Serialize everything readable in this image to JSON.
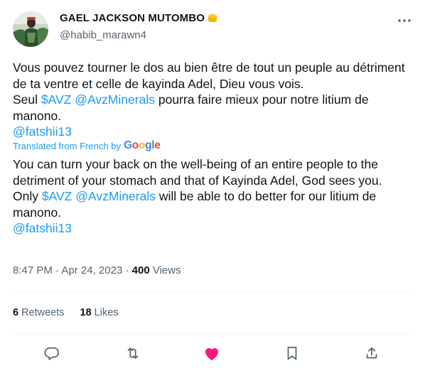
{
  "author": {
    "display_name": "GAEL JACKSON MUTOMBO",
    "name_emoji_icon": "raised-fist-icon",
    "handle": "@habib_marawn4"
  },
  "tweet": {
    "original": {
      "line1": "Vous pouvez tourner le dos au bien être de tout un peuple au détriment de ta ventre et celle de kayinda Adel, Dieu vous vois.",
      "seul": "Seul ",
      "cashtag": "$AVZ",
      "mention": "@AvzMinerals",
      "rest": " pourra faire mieux pour notre litium de manono.",
      "mention2": "@fatshii13"
    },
    "translation_label": "Translated from French by",
    "translation_provider": "Google",
    "translated": {
      "line1": "You can turn your back on the well-being of an entire people to the detriment of your stomach and that of Kayinda Adel, God sees you.",
      "only": "Only ",
      "cashtag": "$AVZ",
      "mention": "@AvzMinerals",
      "rest": " will be able to do better for our litium de manono.",
      "mention2": "@fatshii13"
    },
    "time": "8:47 PM",
    "date": "Apr 24, 2023",
    "views_count": "400",
    "views_label": "Views"
  },
  "stats": {
    "retweets_count": "6",
    "retweets_label": "Retweets",
    "likes_count": "18",
    "likes_label": "Likes"
  },
  "actions": [
    "reply-icon",
    "retweet-icon",
    "like-icon",
    "bookmark-icon",
    "share-icon"
  ],
  "colors": {
    "link": "#1d9bf0",
    "text": "#0f1419",
    "secondary": "#536471",
    "like_active": "#f91880",
    "fist": "#f4b400"
  }
}
